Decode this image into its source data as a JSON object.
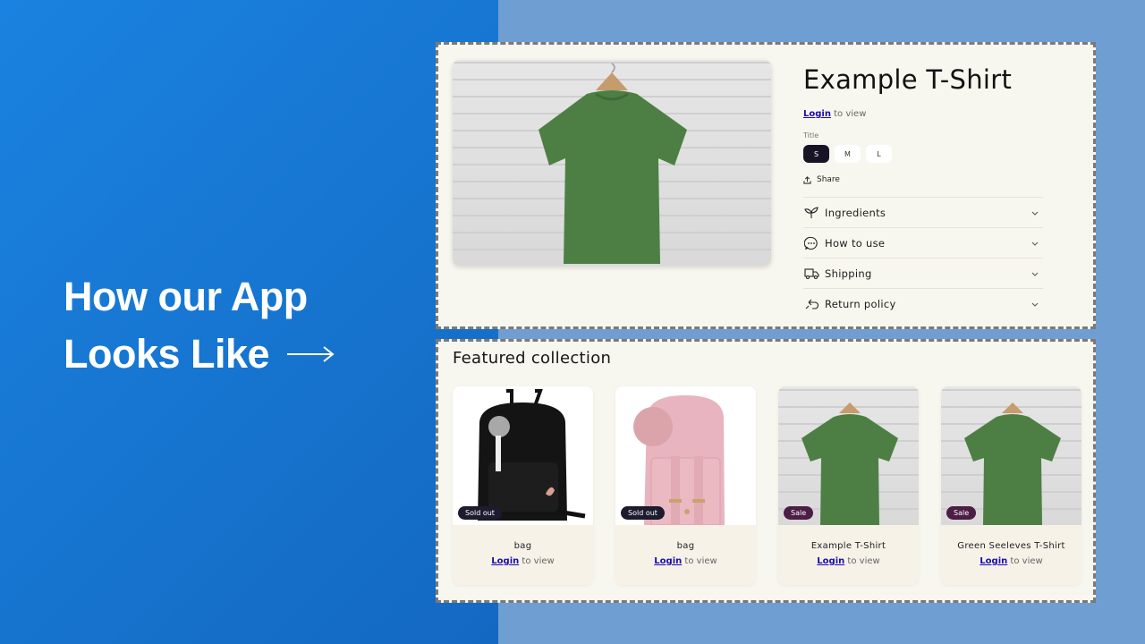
{
  "headline": {
    "line1": "How our App",
    "line2": "Looks Like",
    "arrow_icon": "arrow-right-icon"
  },
  "colors": {
    "left_bg": "#1673cd",
    "right_bg": "#6f9fd2",
    "panel_bg": "#f8f7ef",
    "link": "#1a0dab",
    "badge_sold": "#1d1b2e",
    "badge_sale": "#4c1d45"
  },
  "product": {
    "title": "Example T-Shirt",
    "login_link": "Login",
    "login_suffix": " to view",
    "option_label": "Title",
    "sizes": [
      {
        "label": "S",
        "selected": true
      },
      {
        "label": "M",
        "selected": false
      },
      {
        "label": "L",
        "selected": false
      }
    ],
    "share_label": "Share",
    "accordion": [
      {
        "label": "Ingredients",
        "icon": "leaf-icon"
      },
      {
        "label": "How to use",
        "icon": "chat-bubble-icon"
      },
      {
        "label": "Shipping",
        "icon": "truck-icon"
      },
      {
        "label": "Return policy",
        "icon": "return-arrow-icon"
      }
    ]
  },
  "collection": {
    "title": "Featured collection",
    "items": [
      {
        "name": "bag",
        "badge": "Sold out",
        "login_link": "Login",
        "login_suffix": " to view"
      },
      {
        "name": "bag",
        "badge": "Sold out",
        "login_link": "Login",
        "login_suffix": " to view"
      },
      {
        "name": "Example T-Shirt",
        "badge": "Sale",
        "login_link": "Login",
        "login_suffix": " to view"
      },
      {
        "name": "Green Seeleves T-Shirt",
        "badge": "Sale",
        "login_link": "Login",
        "login_suffix": " to view"
      }
    ]
  }
}
